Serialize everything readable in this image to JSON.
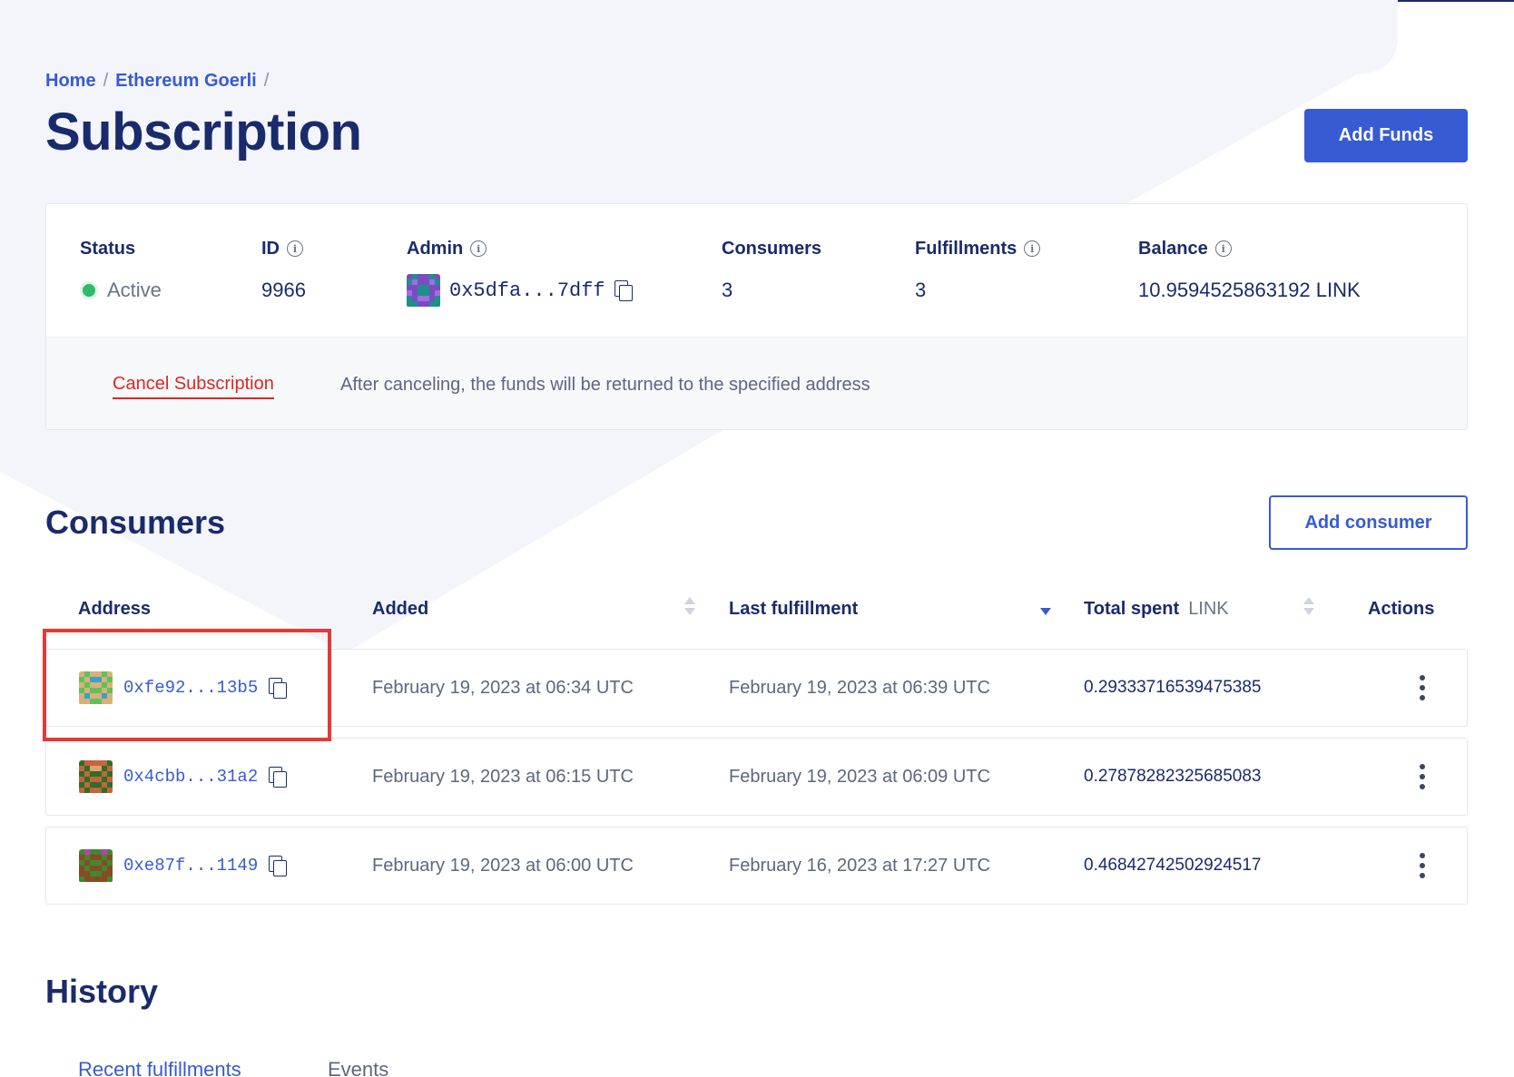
{
  "breadcrumb": {
    "home": "Home",
    "network": "Ethereum Goerli",
    "separator": "/"
  },
  "page_title": "Subscription",
  "add_funds_label": "Add Funds",
  "summary": {
    "status_label": "Status",
    "status_value": "Active",
    "id_label": "ID",
    "id_value": "9966",
    "admin_label": "Admin",
    "admin_value": "0x5dfa...7dff",
    "consumers_label": "Consumers",
    "consumers_value": "3",
    "fulfillments_label": "Fulfillments",
    "fulfillments_value": "3",
    "balance_label": "Balance",
    "balance_value": "10.9594525863192 LINK"
  },
  "cancel": {
    "link_label": "Cancel Subscription",
    "note": "After canceling, the funds will be returned to the specified address"
  },
  "consumers_section": {
    "title": "Consumers",
    "add_label": "Add consumer",
    "columns": {
      "address": "Address",
      "added": "Added",
      "last": "Last fulfillment",
      "spent": "Total spent",
      "spent_unit": "LINK",
      "actions": "Actions"
    },
    "rows": [
      {
        "address": "0xfe92...13b5",
        "added": "February 19, 2023 at 06:34 UTC",
        "last": "February 19, 2023 at 06:39 UTC",
        "spent": "0.29333716539475385"
      },
      {
        "address": "0x4cbb...31a2",
        "added": "February 19, 2023 at 06:15 UTC",
        "last": "February 19, 2023 at 06:09 UTC",
        "spent": "0.27878282325685083"
      },
      {
        "address": "0xe87f...1149",
        "added": "February 19, 2023 at 06:00 UTC",
        "last": "February 16, 2023 at 17:27 UTC",
        "spent": "0.46842742502924517"
      }
    ]
  },
  "history": {
    "title": "History",
    "tabs": [
      "Recent fulfillments",
      "Events"
    ]
  },
  "colors": {
    "brand_blue": "#375bd2",
    "navy": "#1a2b6b",
    "danger": "#de2624",
    "active_green": "#2fb96c",
    "highlight_red": "#e53935"
  }
}
